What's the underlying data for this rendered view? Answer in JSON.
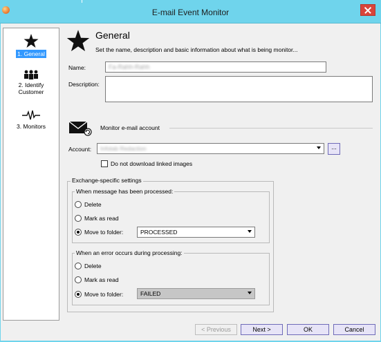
{
  "window": {
    "title": "E-mail Event Monitor"
  },
  "nav": {
    "items": [
      {
        "label": "1. General",
        "icon": "star-icon",
        "active": true
      },
      {
        "label": "2. Identify Customer",
        "icon": "people-icon",
        "active": false
      },
      {
        "label": "3. Monitors",
        "icon": "pulse-icon",
        "active": false
      }
    ]
  },
  "header": {
    "title": "General",
    "subtitle": "Set the name, description and basic information about what is being monitor..."
  },
  "form": {
    "name_label": "Name:",
    "name_value": "Fa-Rahh-Rahh",
    "description_label": "Description:",
    "description_value": ""
  },
  "monitor_account": {
    "section_label": "Monitor e-mail account",
    "account_label": "Account:",
    "account_value": "Infotab Redaction",
    "browse_label": "...",
    "no_download_label": "Do not download linked images",
    "no_download_checked": false
  },
  "exchange": {
    "legend": "Exchange-specific settings",
    "processed": {
      "legend": "When message has been processed:",
      "options": [
        "Delete",
        "Mark as read",
        "Move to folder:"
      ],
      "selected": 2,
      "folder": "PROCESSED"
    },
    "error": {
      "legend": "When an error occurs during processing:",
      "options": [
        "Delete",
        "Mark as read",
        "Move to folder:"
      ],
      "selected": 2,
      "folder": "FAILED"
    }
  },
  "buttons": {
    "previous": "< Previous",
    "next": "Next >",
    "ok": "OK",
    "cancel": "Cancel"
  },
  "colors": {
    "titlebar": "#6fd4ec",
    "selected_nav": "#3399ff",
    "button_fill": "#e7e4f7",
    "button_border": "#6e6ab8"
  }
}
